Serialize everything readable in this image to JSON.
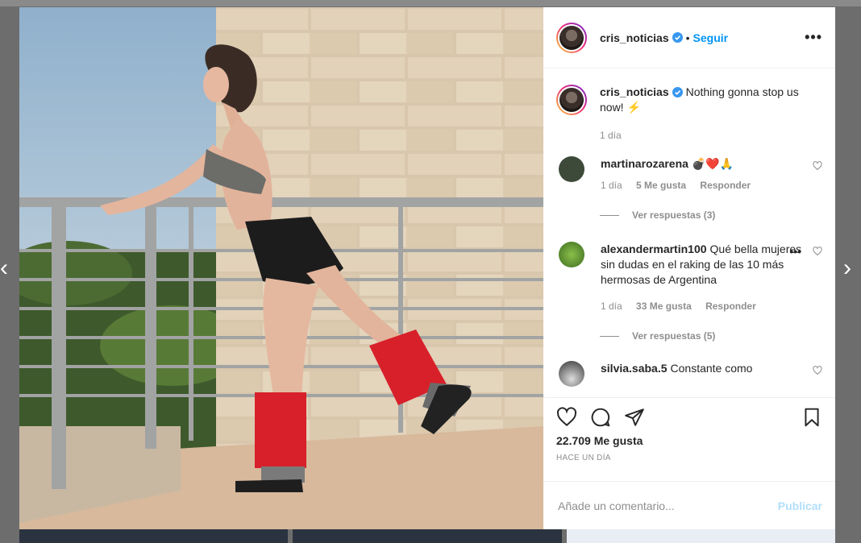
{
  "post": {
    "author": "cris_noticias",
    "follow_label": "Seguir",
    "separator": "•",
    "more_label": "•••",
    "caption": "Nothing gonna stop us now! ⚡",
    "caption_time": "1 día"
  },
  "comments": [
    {
      "user": "martinarozarena",
      "text": "💣❤️🙏",
      "time": "1 día",
      "likes": "5 Me gusta",
      "reply_label": "Responder",
      "view_replies": "Ver respuestas (3)",
      "avatar_color": "#3d4a3a"
    },
    {
      "user": "alexandermartin100",
      "text": "Qué bella mujeres sin dudas en el raking de las 10 más hermosas de Argentina",
      "time": "1 día",
      "likes": "33 Me gusta",
      "reply_label": "Responder",
      "view_replies": "Ver respuestas (5)",
      "avatar_color": "#4f7a2c"
    },
    {
      "user": "silvia.saba.5",
      "text": "Constante como",
      "avatar_color": "#2a2a2a"
    }
  ],
  "stats": {
    "likes": "22.709 Me gusta",
    "time_ago": "HACE UN DÍA"
  },
  "composer": {
    "placeholder": "Añade un comentario...",
    "publish_label": "Publicar"
  },
  "nav": {
    "prev": "‹",
    "next": "›"
  },
  "colors": {
    "accent": "#0095f6",
    "publish_disabled": "#b2dffc",
    "legwarmer": "#d8202a"
  }
}
